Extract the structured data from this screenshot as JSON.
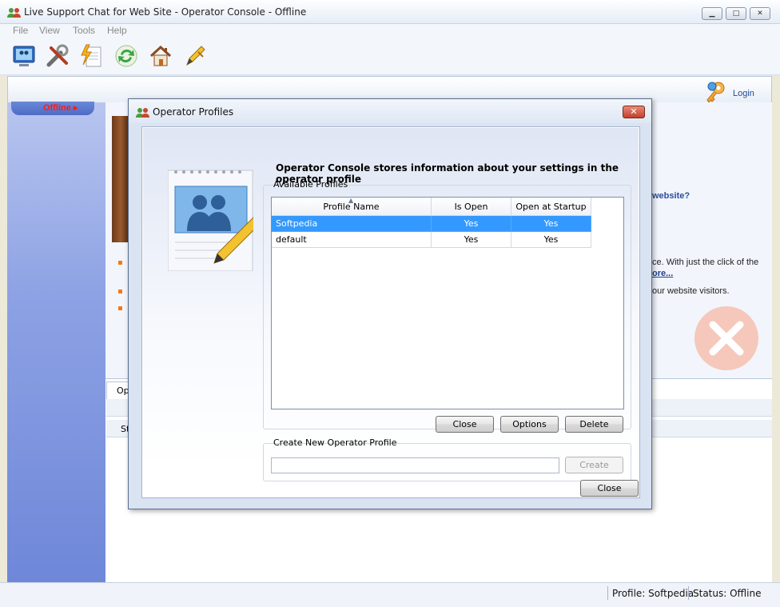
{
  "window": {
    "title": "Live Support Chat for Web Site - Operator Console - Offline",
    "minimize": "▁",
    "maximize": "□",
    "close": "✕"
  },
  "menu": [
    "File",
    "View",
    "Tools",
    "Help"
  ],
  "toolbar": {
    "icons": [
      "monitor-icon",
      "tools-icon",
      "document-lightning-icon",
      "refresh-icon",
      "home-icon",
      "pen-icon"
    ]
  },
  "header": {
    "login_label": "Login"
  },
  "sidebar": {
    "status_label": "Offline ▸"
  },
  "background": {
    "partial_texts": [
      "website?",
      "ce. With just the click of the",
      "ore...",
      "our website visitors."
    ],
    "lower_tab_label": "Op",
    "lower_row_label": "St"
  },
  "statusbar": {
    "profile": "Profile: Softpedia",
    "status": "Status: Offline"
  },
  "dialog": {
    "title": "Operator Profiles",
    "close_glyph": "✕",
    "heading": "Operator Console stores information about your settings in the operator profile",
    "available_profiles_label": "Available Profiles",
    "columns": [
      "Profile Name",
      "Is Open",
      "Open at Startup"
    ],
    "rows": [
      {
        "name": "Softpedia",
        "is_open": "Yes",
        "startup": "Yes",
        "selected": true
      },
      {
        "name": "default",
        "is_open": "Yes",
        "startup": "Yes",
        "selected": false
      }
    ],
    "buttons": {
      "close": "Close",
      "options": "Options",
      "delete": "Delete"
    },
    "create_group_label": "Create New Operator Profile",
    "create_input_value": "",
    "create_button": "Create",
    "bottom_close": "Close"
  }
}
